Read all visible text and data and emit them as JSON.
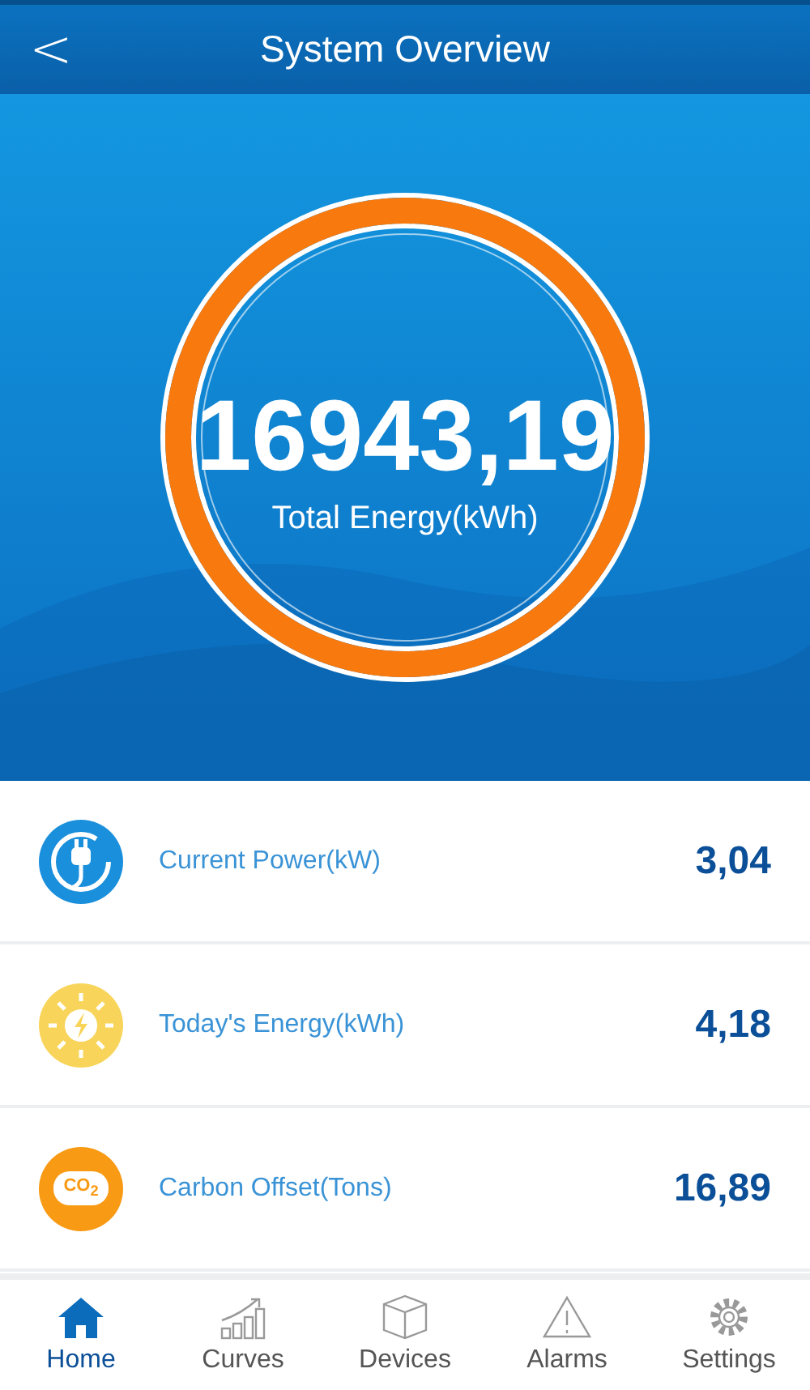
{
  "header": {
    "back": "<",
    "title": "System Overview"
  },
  "hero": {
    "value": "16943,19",
    "label": "Total Energy(kWh)"
  },
  "metrics": [
    {
      "kind": "power",
      "label": "Current Power(kW)",
      "value": "3,04"
    },
    {
      "kind": "solar",
      "label": "Today's Energy(kWh)",
      "value": "4,18"
    },
    {
      "kind": "carbon",
      "label": "Carbon Offset(Tons)",
      "value": "16,89",
      "icon_text": "CO$_{2}$"
    }
  ],
  "nav": [
    {
      "kind": "home",
      "label": "Home",
      "selected": true
    },
    {
      "kind": "curves",
      "label": "Curves",
      "selected": false
    },
    {
      "kind": "devices",
      "label": "Devices",
      "selected": false
    },
    {
      "kind": "alarms",
      "label": "Alarms",
      "selected": false
    },
    {
      "kind": "settings",
      "label": "Settings",
      "selected": false
    }
  ]
}
